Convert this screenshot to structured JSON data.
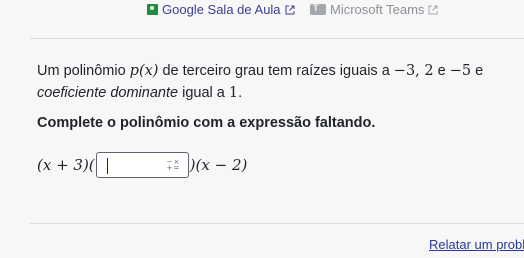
{
  "top_links": {
    "classroom": "Google Sala de Aula",
    "teams": "Microsoft Teams"
  },
  "question": {
    "line1_pre": "Um polinômio ",
    "poly_name": "p(x)",
    "line1_mid": " de terceiro grau tem raízes iguais a ",
    "roots_text": "−3, 2",
    "line1_e": " e ",
    "root_last": "−5",
    "line1_end": " e",
    "line2_italic": "coeficiente dominante",
    "line2_mid": " igual a ",
    "leading_coef": "1",
    "line2_end": ".",
    "instruction": "Complete o polinômio com a expressão faltando."
  },
  "expression": {
    "left": "(x + 3)(",
    "right": ")(x − 2)",
    "input_value": "",
    "keypad_symbols": "−×\n+="
  },
  "footer": {
    "report_label": "Relatar um problema"
  }
}
